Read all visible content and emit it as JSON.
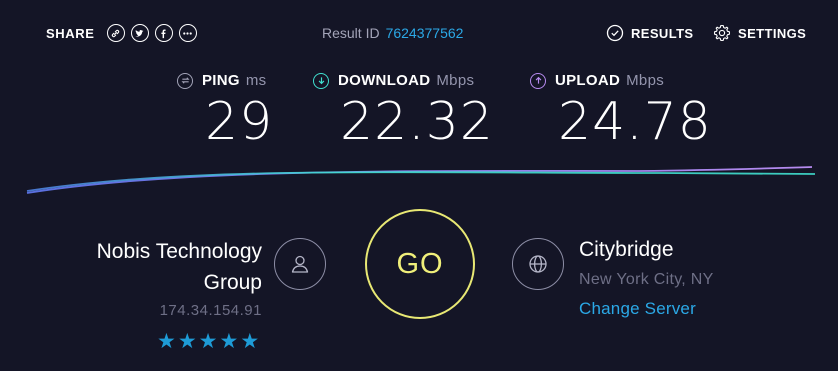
{
  "header": {
    "share_label": "SHARE",
    "share_buttons": [
      {
        "icon": "link-icon"
      },
      {
        "icon": "twitter-icon"
      },
      {
        "icon": "facebook-icon"
      },
      {
        "icon": "more-icon"
      }
    ],
    "result_label": "Result ID",
    "result_id": "7624377562",
    "results_label": "RESULTS",
    "settings_label": "SETTINGS"
  },
  "metrics": {
    "ping": {
      "label": "PING",
      "unit": "ms",
      "value": "29",
      "icon": "ping-icon",
      "color": "#ffffff"
    },
    "download": {
      "label": "DOWNLOAD",
      "unit": "Mbps",
      "value": "22.32",
      "icon": "download-icon",
      "color": "#40e0d0"
    },
    "upload": {
      "label": "UPLOAD",
      "unit": "Mbps",
      "value": "24.78",
      "icon": "upload-icon",
      "color": "#b78bf0"
    }
  },
  "isp": {
    "name_line1": "Nobis Technology",
    "name_line2": "Group",
    "ip": "174.34.154.91",
    "rating": 5,
    "icon": "user-icon"
  },
  "go_label": "GO",
  "server": {
    "name": "Citybridge",
    "location": "New York City, NY",
    "change_label": "Change Server",
    "icon": "globe-icon"
  },
  "colors": {
    "background": "#141526",
    "accent_blue": "#2ba8e6",
    "go_yellow": "#e8e874",
    "download_line": "#40e0d0",
    "upload_line": "#b78bf0"
  }
}
